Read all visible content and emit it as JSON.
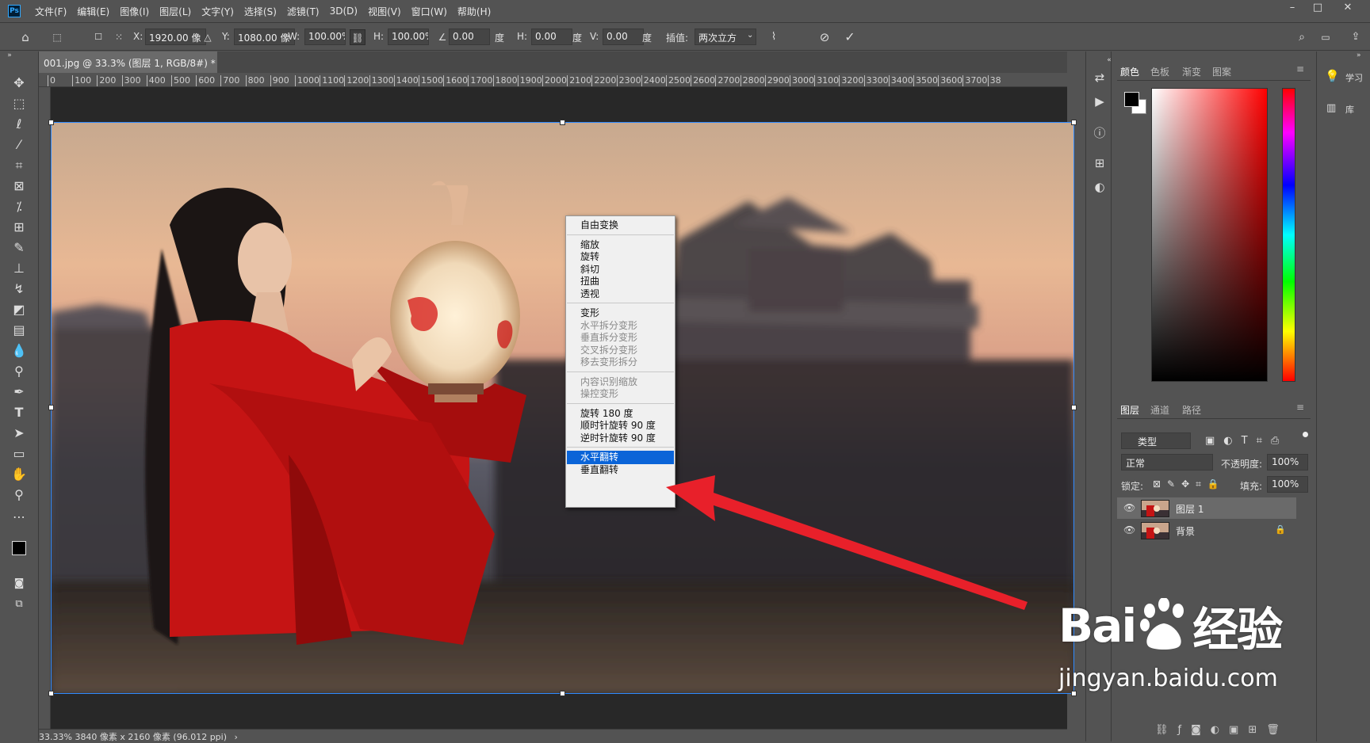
{
  "menubar": {
    "logo": "Ps",
    "items": [
      "文件(F)",
      "编辑(E)",
      "图像(I)",
      "图层(L)",
      "文字(Y)",
      "选择(S)",
      "滤镜(T)",
      "3D(D)",
      "视图(V)",
      "窗口(W)",
      "帮助(H)"
    ],
    "window_controls": [
      "–",
      "□",
      "✕"
    ]
  },
  "options": {
    "x_label": "X:",
    "x_value": "1920.00 像",
    "y_label": "Y:",
    "y_value": "1080.00 像",
    "w_label": "W:",
    "w_value": "100.00%",
    "h_label": "H:",
    "h_value": "100.00%",
    "angle_value": "0.00",
    "angle_unit": "度",
    "hskew_label": "H:",
    "hskew_value": "0.00",
    "hskew_unit": "度",
    "vskew_label": "V:",
    "vskew_value": "0.00",
    "vskew_unit": "度",
    "interp_label": "插值:",
    "interp_value": "两次立方"
  },
  "document": {
    "tab_title": "001.jpg @ 33.3% (图层 1, RGB/8#) *",
    "tab_close": "×",
    "status": "33.33%  3840 像素 x 2160 像素 (96.012 ppi)"
  },
  "ruler": {
    "h_ticks": [
      "0",
      "100",
      "200",
      "300",
      "400",
      "500",
      "600",
      "700",
      "800",
      "900",
      "1000",
      "1100",
      "1200",
      "1300",
      "1400",
      "1500",
      "1600",
      "1700",
      "1800",
      "1900",
      "2000",
      "2100",
      "2200",
      "2300",
      "2400",
      "2500",
      "2600",
      "2700",
      "2800",
      "2900",
      "3000",
      "3100",
      "3200",
      "3300",
      "3400",
      "3500",
      "3600",
      "3700",
      "38"
    ]
  },
  "context_menu": {
    "groups": [
      [
        {
          "label": "自由变换",
          "disabled": false
        }
      ],
      [
        {
          "label": "缩放",
          "disabled": false
        },
        {
          "label": "旋转",
          "disabled": false
        },
        {
          "label": "斜切",
          "disabled": false
        },
        {
          "label": "扭曲",
          "disabled": false
        },
        {
          "label": "透视",
          "disabled": false
        }
      ],
      [
        {
          "label": "变形",
          "disabled": false
        },
        {
          "label": "水平拆分变形",
          "disabled": true
        },
        {
          "label": "垂直拆分变形",
          "disabled": true
        },
        {
          "label": "交叉拆分变形",
          "disabled": true
        },
        {
          "label": "移去变形拆分",
          "disabled": true
        }
      ],
      [
        {
          "label": "内容识别缩放",
          "disabled": true
        },
        {
          "label": "操控变形",
          "disabled": true
        }
      ],
      [
        {
          "label": "旋转 180 度",
          "disabled": false
        },
        {
          "label": "顺时针旋转 90 度",
          "disabled": false
        },
        {
          "label": "逆时针旋转 90 度",
          "disabled": false
        }
      ],
      [
        {
          "label": "水平翻转",
          "disabled": false,
          "selected": true
        },
        {
          "label": "垂直翻转",
          "disabled": false
        }
      ]
    ]
  },
  "color_panel": {
    "tabs": [
      "颜色",
      "色板",
      "渐变",
      "图案"
    ],
    "foreground": "#000000",
    "background": "#ffffff"
  },
  "layers_panel": {
    "tabs": [
      "图层",
      "通道",
      "路径"
    ],
    "filter": "类型",
    "blend_mode": "正常",
    "opacity_label": "不透明度:",
    "opacity_value": "100%",
    "lock_label": "锁定:",
    "fill_label": "填充:",
    "fill_value": "100%",
    "layers": [
      {
        "name": "图层 1",
        "active": true,
        "locked": false
      },
      {
        "name": "背景",
        "active": false,
        "locked": true
      }
    ]
  },
  "right_dock": {
    "items": [
      {
        "label": "学习"
      },
      {
        "label": "库"
      }
    ]
  },
  "watermark": {
    "brand_left": "Bai",
    "brand_right": "经验",
    "url": "jingyan.baidu.com"
  },
  "colors": {
    "ui_bg": "#535353",
    "menu_highlight": "#0a64d8",
    "arrow": "#e8202a"
  }
}
